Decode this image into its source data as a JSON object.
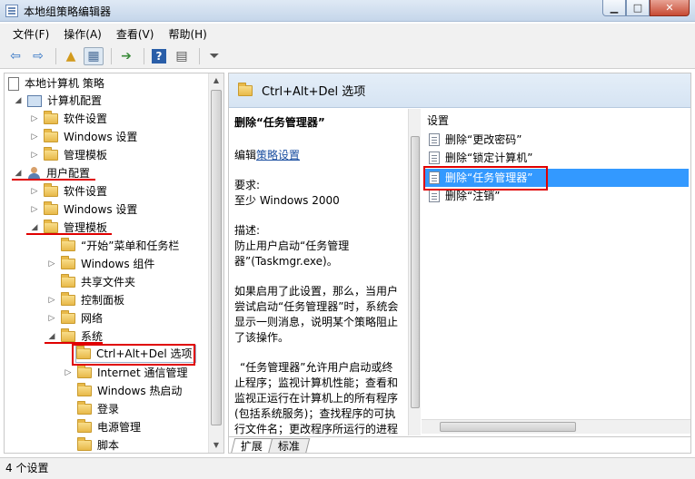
{
  "window": {
    "title": "本地组策略编辑器"
  },
  "menu": [
    "文件(F)",
    "操作(A)",
    "查看(V)",
    "帮助(H)"
  ],
  "toolbar": {
    "icons": [
      "back-arrow-icon",
      "forward-arrow-icon",
      "up-folder-icon",
      "show-hide-tree-icon",
      "export-list-icon",
      "help-icon",
      "properties-icon",
      "filter-icon"
    ]
  },
  "tree": [
    {
      "label": "本地计算机 策略",
      "icon": "doc"
    },
    {
      "label": "计算机配置",
      "icon": "pc"
    },
    {
      "label": "软件设置",
      "icon": "folder"
    },
    {
      "label": "Windows 设置",
      "icon": "folder"
    },
    {
      "label": "管理模板",
      "icon": "folder"
    },
    {
      "label": "用户配置",
      "icon": "user"
    },
    {
      "label": "软件设置",
      "icon": "folder"
    },
    {
      "label": "Windows 设置",
      "icon": "folder"
    },
    {
      "label": "管理模板",
      "icon": "folder"
    },
    {
      "label": "“开始”菜单和任务栏",
      "icon": "folder"
    },
    {
      "label": "Windows 组件",
      "icon": "folder"
    },
    {
      "label": "共享文件夹",
      "icon": "folder"
    },
    {
      "label": "控制面板",
      "icon": "folder"
    },
    {
      "label": "网络",
      "icon": "folder"
    },
    {
      "label": "系统",
      "icon": "folder"
    },
    {
      "label": "Ctrl+Alt+Del 选项",
      "icon": "folder"
    },
    {
      "label": "Internet 通信管理",
      "icon": "folder"
    },
    {
      "label": "Windows 热启动",
      "icon": "folder"
    },
    {
      "label": "登录",
      "icon": "folder"
    },
    {
      "label": "电源管理",
      "icon": "folder"
    },
    {
      "label": "脚本",
      "icon": "folder"
    }
  ],
  "right": {
    "header": "Ctrl+Alt+Del 选项",
    "desc": {
      "title": "删除“任务管理器”",
      "edit_prefix": "编辑",
      "edit_link": "策略设置",
      "req_label": "要求:",
      "req_value": "至少 Windows 2000",
      "desc_label": "描述:",
      "desc_text": "防止用户启动“任务管理器”(Taskmgr.exe)。",
      "para1": "如果启用了此设置，那么，当用户尝试启动“任务管理器”时，系统会显示一则消息，说明某个策略阻止了该操作。",
      "para2": "“任务管理器”允许用户启动或终止程序；监视计算机性能；查看和监视正运行在计算机上的所有程序(包括系统服务)；查找程序的可执行文件名；更改程序所运行的进程"
    },
    "list_header": "设置",
    "settings": [
      "删除“更改密码”",
      "删除“锁定计算机”",
      "删除“任务管理器”",
      "删除“注销”"
    ],
    "tabs": [
      "扩展",
      "标准"
    ]
  },
  "status": "4 个设置",
  "colors": {
    "selection": "#3399ff",
    "highlight_red": "#e00000"
  }
}
